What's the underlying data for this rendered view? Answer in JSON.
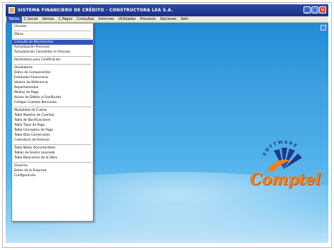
{
  "window": {
    "title": "SISTEMA FINANCIERO DE CRÉDITO - CONSTRUCTORA LEA S.A.",
    "controls": [
      "minimize",
      "maximize",
      "close"
    ]
  },
  "menubar": {
    "items": [
      "Tablas",
      "C.Social",
      "Ventas",
      "C.Pagos",
      "Consultas",
      "Informes",
      "Utilidades",
      "Procesos",
      "Opciones",
      "Salir"
    ],
    "active_index": 0
  },
  "dropdown": {
    "groups": [
      [
        "Clientes"
      ],
      [
        "Obras"
      ],
      [
        "Consulta de Movimientos",
        "Actualización Procesos",
        "Actualización Consolidar en Proceso"
      ],
      [
        "Parámetros para Certificación"
      ],
      [
        "Vendedores",
        "Datos de Componentes",
        "Entidades Financieras",
        "Valores de Referencia",
        "Departamentos",
        "Medios de Pago",
        "Avisos de Débito al Sanificado",
        "Códigos Cuentas Bancarias"
      ],
      [
        "Modalidad de Cuotas",
        "Tabla Maestro de Cuentas",
        "Tabla de Bonificaciones",
        "Tabla Tipos de Pago",
        "Tabla Conceptos de Pago",
        "Tabla Días Comerciales",
        "Calendario de Festivos"
      ],
      [
        "Tabla Notas Documentales",
        "Tablas de Gestor asociado",
        "Tabla Relaciones de la Obra"
      ],
      [
        "Usuarios",
        "Datos de la Empresa",
        "Configuración"
      ]
    ],
    "selected": "Consulta de Movimientos"
  },
  "logo": {
    "text": "Comptel",
    "arc_text": "SOFTWARE",
    "colors": {
      "orange": "#f08020",
      "blue": "#1f3a8a"
    }
  }
}
